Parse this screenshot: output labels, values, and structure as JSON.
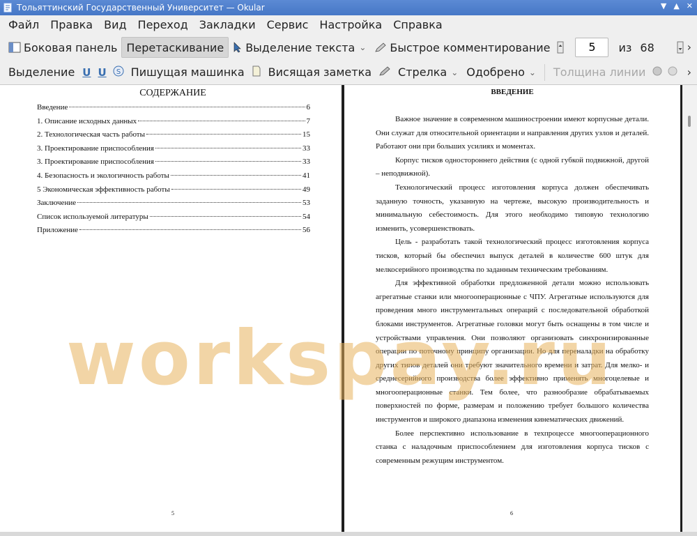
{
  "window": {
    "title": "Тольяттинский  Государственный  Университет  — Okular"
  },
  "menubar": {
    "items": [
      "Файл",
      "Правка",
      "Вид",
      "Переход",
      "Закладки",
      "Сервис",
      "Настройка",
      "Справка"
    ]
  },
  "toolbar1": {
    "sidebar": "Боковая панель",
    "drag": "Перетаскивание",
    "text_select": "Выделение текста",
    "quick_comment": "Быстрое комментирование",
    "page_current": "5",
    "page_of": "из",
    "page_total": "68"
  },
  "toolbar2": {
    "highlight": "Выделение",
    "typewriter": "Пишущая машинка",
    "popup_note": "Висящая заметка",
    "arrow": "Стрелка",
    "approved": "Одобрено",
    "line_width": "Толщина линии"
  },
  "page_left": {
    "heading": "СОДЕРЖАНИЕ",
    "toc": [
      {
        "title": "Введение",
        "page": "6"
      },
      {
        "title": "1. Описание исходных данных",
        "page": "7"
      },
      {
        "title": "2. Технологическая часть работы",
        "page": "15"
      },
      {
        "title": "3. Проектирование приспособления",
        "page": "33"
      },
      {
        "title": "3. Проектирование приспособления",
        "page": "33"
      },
      {
        "title": "4. Безопасность и экологичность работы",
        "page": "41"
      },
      {
        "title": "5 Экономическая эффективность работы",
        "page": "49"
      },
      {
        "title": "Заключение",
        "page": "53"
      },
      {
        "title": "Список используемой литературы",
        "page": "54"
      },
      {
        "title": "Приложение",
        "page": "56"
      }
    ],
    "page_number": "5"
  },
  "page_right": {
    "heading": "ВВЕДЕНИЕ",
    "paragraphs": [
      "Важное значение в современном машиностроении имеют корпусные детали. Они служат для относительной ориентации и направления других узлов и деталей. Работают они при больших усилиях и моментах.",
      "Корпус тисков одностороннего действия (с одной губкой подвижной, другой – неподвижной).",
      "Технологический процесс изготовления корпуса должен обеспечивать заданную точность, указанную на чертеже, высокую производительность и минимальную себестоимость. Для этого необходимо типовую технологию изменить, усовершенствовать.",
      "Цель - разработать такой технологический процесс изготовления корпуса тисков, который бы обеспечил выпуск деталей в количестве 600 штук для мелкосерийного производства по заданным техническим требованиям.",
      "Для эффективной обработки предложенной детали можно использовать агрегатные станки или многооперационные с ЧПУ. Агрегатные используются для проведения много инструментальных операций с последовательной обработкой блоками инструментов. Агрегатные головки могут быть оснащены в том числе и устройствами управления. Они позволяют организовать синхронизированные операции по поточному принципу организации. Но для переналадки на обработку других типов деталей они требуют значительного времени и затрат. Для мелко- и среднесерийного производства более эффективно применять многоцелевые и многооперационные станки. Тем более, что разнообразие обрабатываемых поверхностей по форме, размерам и положению требует большого количества инструментов и широкого диапазона изменения кинематических движений.",
      "Более перспективно использование в техпроцессе многооперационного станка с наладочным приспособлением для изготовления корпуса тисков с современным режущим инструментом."
    ],
    "page_number": "6"
  },
  "watermark": "workspay.ru"
}
